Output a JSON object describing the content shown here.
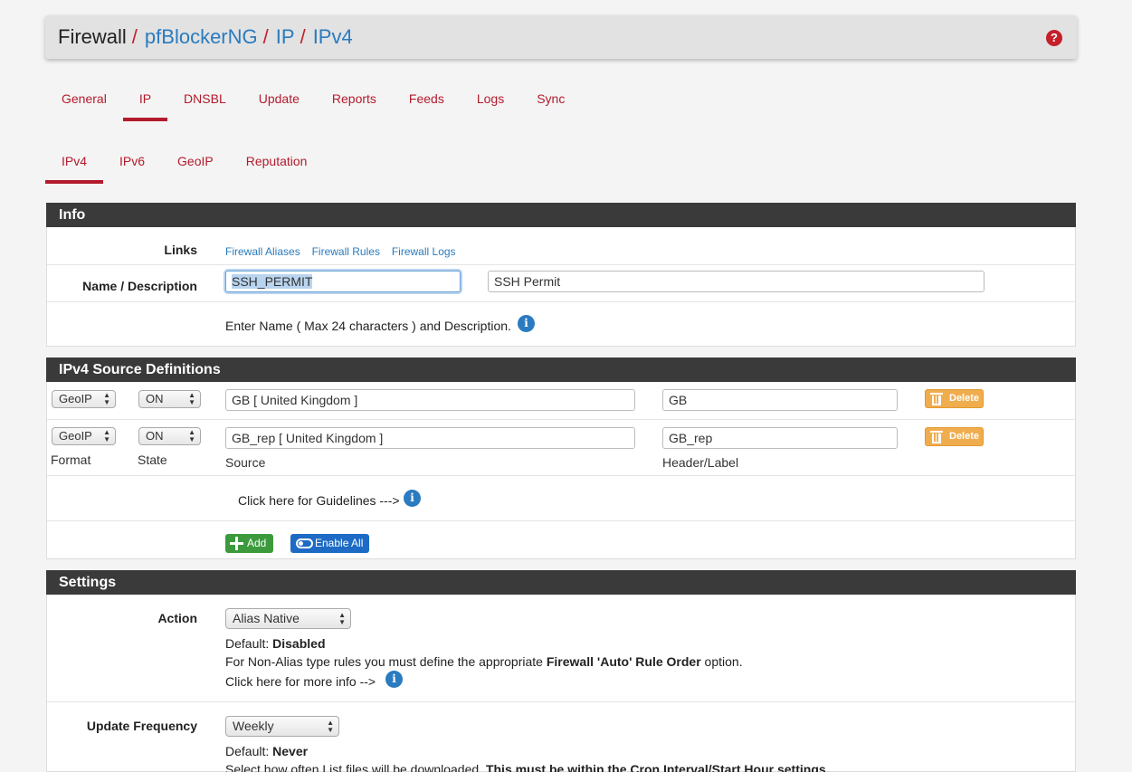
{
  "breadcrumb": {
    "root": "Firewall",
    "items": [
      "pfBlockerNG",
      "IP",
      "IPv4"
    ],
    "separator": "/",
    "help_icon": "question-circle-icon"
  },
  "main_tabs": [
    {
      "label": "General",
      "active": false
    },
    {
      "label": "IP",
      "active": true
    },
    {
      "label": "DNSBL",
      "active": false
    },
    {
      "label": "Update",
      "active": false
    },
    {
      "label": "Reports",
      "active": false
    },
    {
      "label": "Feeds",
      "active": false
    },
    {
      "label": "Logs",
      "active": false
    },
    {
      "label": "Sync",
      "active": false
    }
  ],
  "sub_tabs": [
    {
      "label": "IPv4",
      "active": true
    },
    {
      "label": "IPv6",
      "active": false
    },
    {
      "label": "GeoIP",
      "active": false
    },
    {
      "label": "Reputation",
      "active": false
    }
  ],
  "info": {
    "title": "Info",
    "links_label": "Links",
    "links": [
      "Firewall Aliases",
      "Firewall Rules",
      "Firewall Logs"
    ],
    "name_label": "Name / Description",
    "name_value": "SSH_PERMIT",
    "description_value": "SSH Permit",
    "help_text": "Enter Name ( Max 24 characters ) and Description."
  },
  "sources": {
    "title": "IPv4 Source Definitions",
    "rows": [
      {
        "format": "GeoIP",
        "state": "ON",
        "source": "GB [ United Kingdom ]",
        "header": "GB",
        "delete_label": "Delete"
      },
      {
        "format": "GeoIP",
        "state": "ON",
        "source": "GB_rep [ United Kingdom ]",
        "header": "GB_rep",
        "delete_label": "Delete"
      }
    ],
    "col_labels": {
      "format": "Format",
      "state": "State",
      "source": "Source",
      "header": "Header/Label"
    },
    "guidelines_text": "Click here for Guidelines --->",
    "add_label": "Add",
    "enable_all_label": "Enable All"
  },
  "settings": {
    "title": "Settings",
    "action_label": "Action",
    "action_value": "Alias Native",
    "action_default_prefix": "Default:",
    "action_default_value": "Disabled",
    "action_note_prefix": "For Non-Alias type rules you must define the appropriate",
    "action_note_bold": "Firewall 'Auto' Rule Order",
    "action_note_suffix": "option.",
    "action_more_info": "Click here for more info -->",
    "update_label": "Update Frequency",
    "update_value": "Weekly",
    "update_default_prefix": "Default:",
    "update_default_value": "Never",
    "update_note_prefix": "Select how often List files will be downloaded.",
    "update_note_bold": "This must be within the Cron Interval/Start Hour settings."
  },
  "colors": {
    "accent_red": "#b31b2c",
    "link_blue": "#2a7bbf",
    "panel_header": "#3a3a3a",
    "delete_orange": "#f0ad4e",
    "add_green": "#3c9a3c",
    "enable_blue": "#1d6bc4"
  }
}
